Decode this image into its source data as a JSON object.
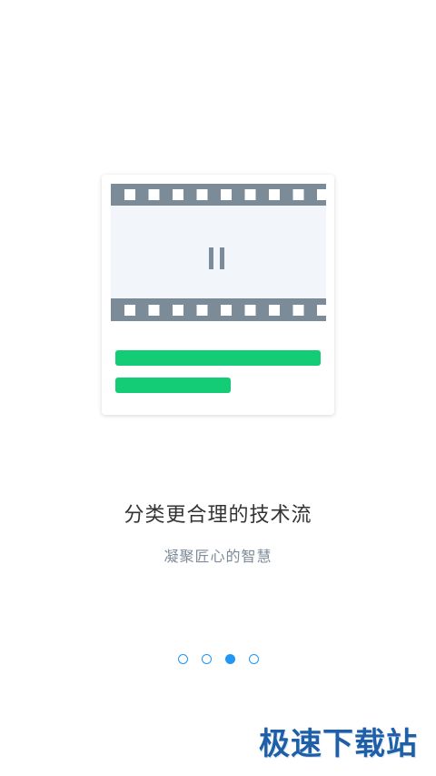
{
  "onboarding": {
    "title": "分类更合理的技术流",
    "subtitle": "凝聚匠心的智慧",
    "page_count": 4,
    "current_page": 3
  },
  "illustration": {
    "icon": "film-pause-icon",
    "film_color": "#7b8b98",
    "screen_color": "#f2f6fb",
    "bar_color": "#13cc75"
  },
  "watermark": {
    "text": "极速下载站"
  },
  "colors": {
    "accent": "#2196f3",
    "title": "#333333",
    "subtitle": "#7d8a99"
  }
}
